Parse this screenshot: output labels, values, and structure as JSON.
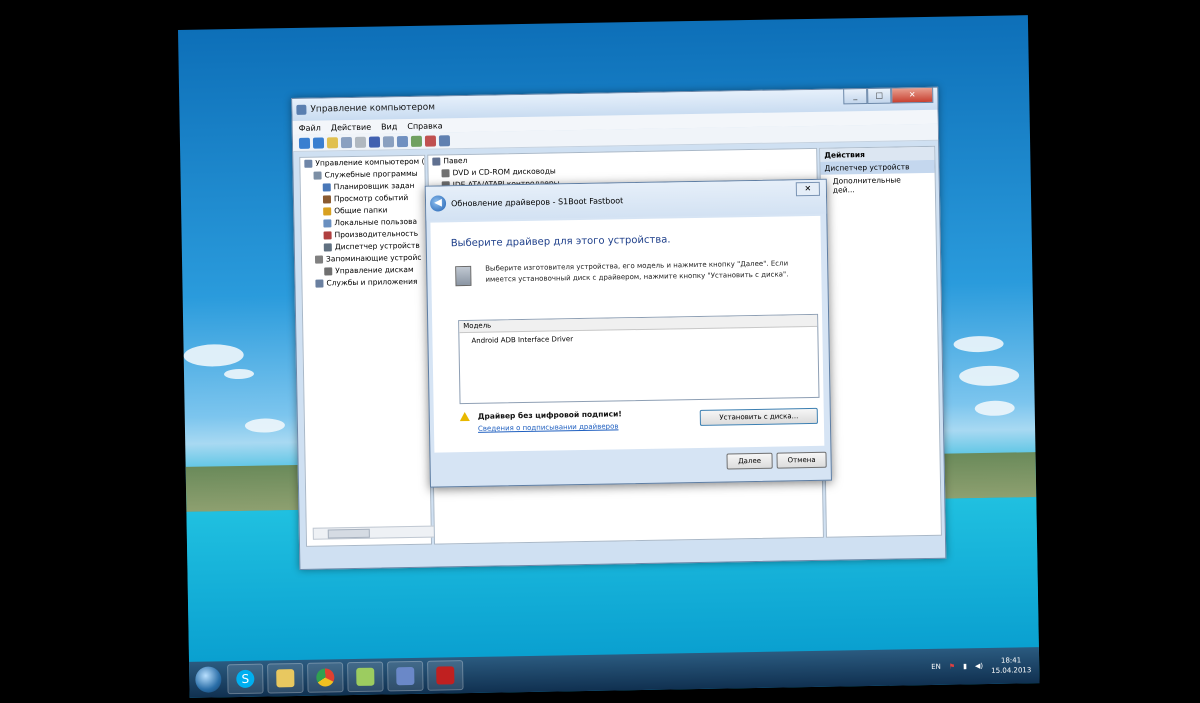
{
  "window": {
    "title": "Управление компьютером",
    "controls": [
      "_",
      "□",
      "✕"
    ],
    "menu": [
      "Файл",
      "Действие",
      "Вид",
      "Справка"
    ]
  },
  "tree_left": [
    {
      "label": "Управление компьютером (л",
      "indent": 0,
      "color": "#6f86a8"
    },
    {
      "label": "Служебные программы",
      "indent": 1,
      "color": "#7c8fa5"
    },
    {
      "label": "Планировщик задан",
      "indent": 2,
      "color": "#4a78b8"
    },
    {
      "label": "Просмотр событий",
      "indent": 2,
      "color": "#8a5a30"
    },
    {
      "label": "Общие папки",
      "indent": 2,
      "color": "#d8a020"
    },
    {
      "label": "Локальные пользова",
      "indent": 2,
      "color": "#6a90c0"
    },
    {
      "label": "Производительность",
      "indent": 2,
      "color": "#b04040"
    },
    {
      "label": "Диспетчер устройств",
      "indent": 2,
      "color": "#607080"
    },
    {
      "label": "Запоминающие устройс",
      "indent": 1,
      "color": "#808080"
    },
    {
      "label": "Управление дискам",
      "indent": 2,
      "color": "#707070"
    },
    {
      "label": "Службы и приложения",
      "indent": 1,
      "color": "#6a80a0"
    }
  ],
  "tree_mid": [
    {
      "label": "Павел",
      "indent": 0,
      "color": "#607090"
    },
    {
      "label": "DVD и CD-ROM дисководы",
      "indent": 1,
      "color": "#707070"
    },
    {
      "label": "IDE ATA/ATAPI контроллеры",
      "indent": 1,
      "color": "#707070"
    }
  ],
  "actions": {
    "header": "Действия",
    "selected": "Диспетчер устройств",
    "item": "Дополнительные дей..."
  },
  "dialog": {
    "title": "Обновление драйверов - S1Boot Fastboot",
    "heading": "Выберите драйвер для этого устройства.",
    "info": "Выберите изготовителя устройства, его модель и нажмите кнопку \"Далее\". Если имеется установочный диск с драйвером, нажмите кнопку \"Установить с диска\".",
    "list_header": "Модель",
    "list_items": [
      "Android ADB Interface Driver"
    ],
    "warning": "Драйвер без цифровой подписи!",
    "link": "Сведения о подписывании драйверов",
    "install_button": "Установить с диска...",
    "next_button": "Далее",
    "cancel_button": "Отмена"
  },
  "taskbar": {
    "apps": [
      {
        "name": "skype",
        "color": "#00aff0",
        "label": "S"
      },
      {
        "name": "explorer",
        "color": "#e8c860"
      },
      {
        "name": "chrome",
        "color": "#e04030"
      },
      {
        "name": "notepad",
        "color": "#9ccc60"
      },
      {
        "name": "device-manager",
        "color": "#6a88c8"
      },
      {
        "name": "flash-tool",
        "color": "#c02020"
      }
    ],
    "lang": "EN",
    "time": "18:41",
    "date": "15.04.2013"
  }
}
